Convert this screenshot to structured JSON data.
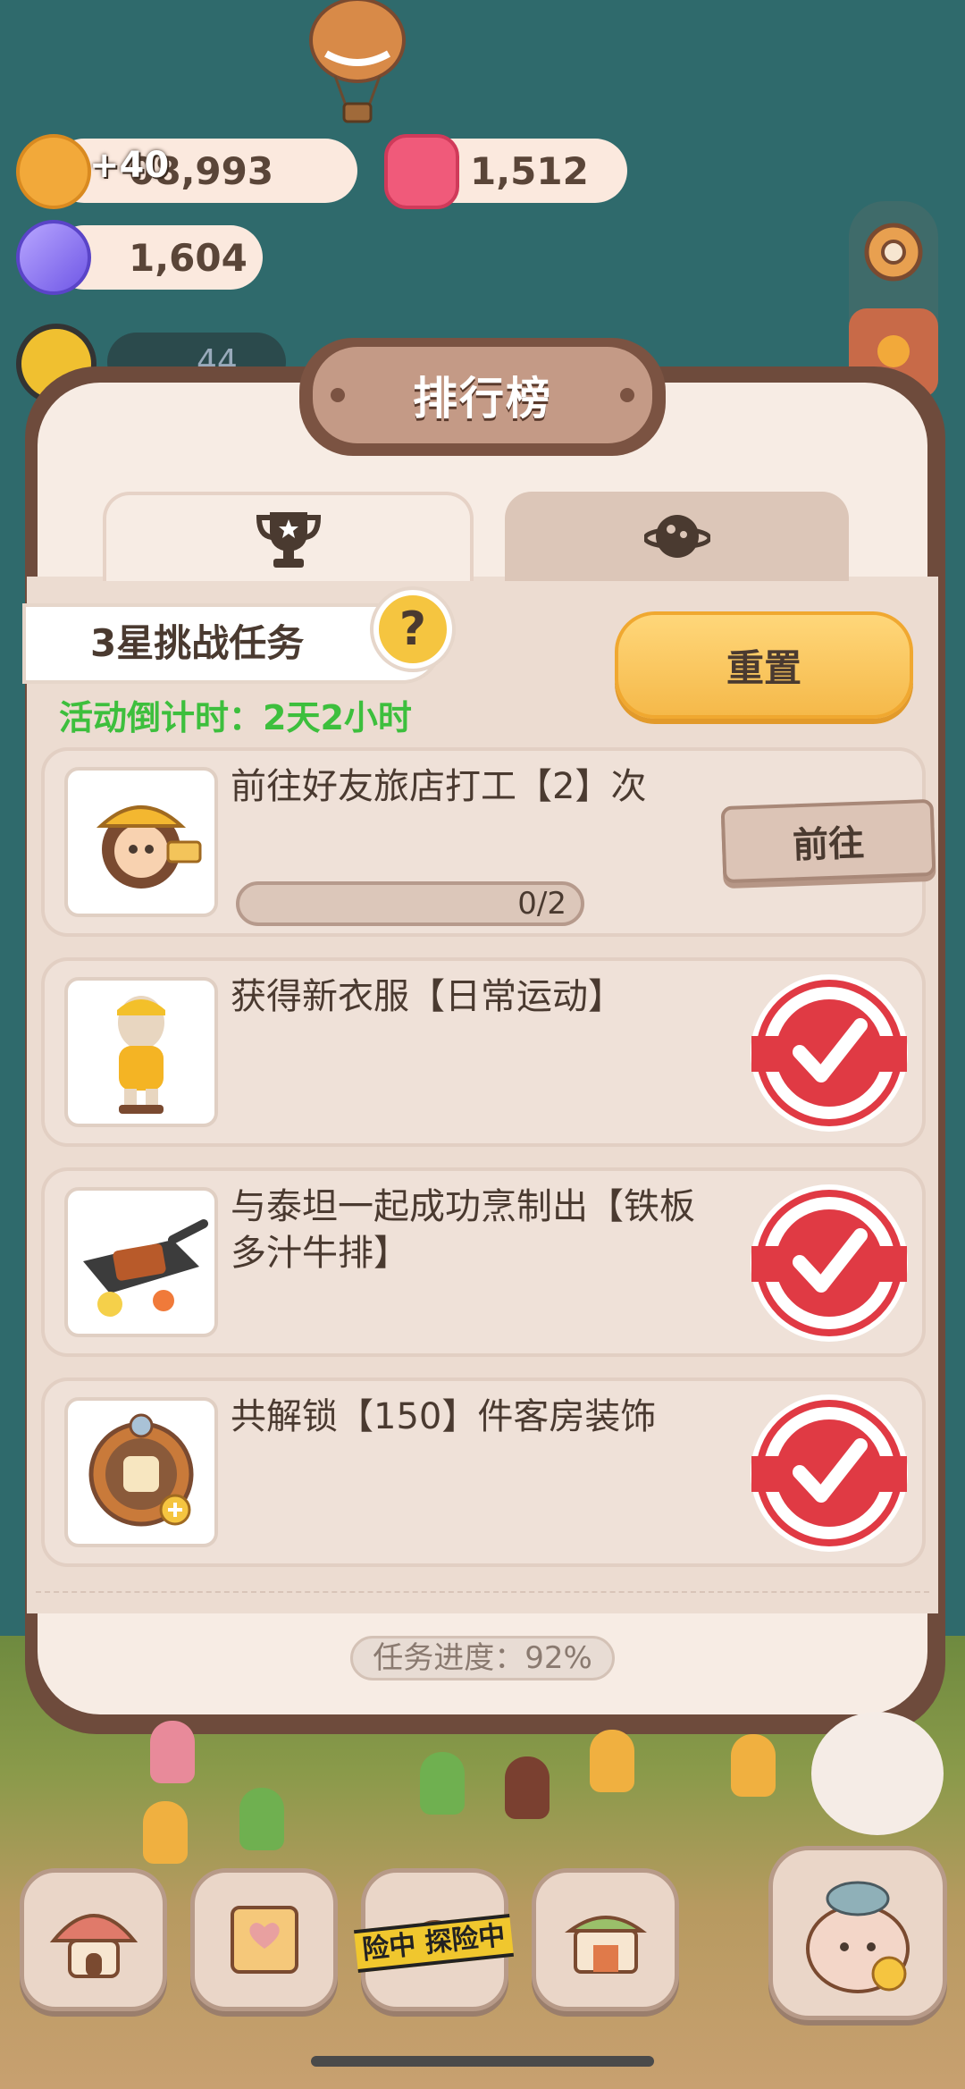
{
  "resources": {
    "cookies": {
      "plus": "+40",
      "value": "08,993",
      "icon": "cookie-icon"
    },
    "gems": {
      "value": "1,512",
      "icon": "pink-gem-icon"
    },
    "crystals": {
      "value": "1,604",
      "icon": "crystal-icon"
    },
    "partial_count": "44"
  },
  "panel": {
    "title": "排行榜",
    "tabs": [
      {
        "icon": "trophy-icon",
        "active": true
      },
      {
        "icon": "planet-icon",
        "active": false
      }
    ],
    "challenge_label": "3星挑战任务",
    "help_symbol": "?",
    "countdown": "活动倒计时：2天2小时",
    "reset_label": "重置",
    "tasks": [
      {
        "text": "前往好友旅店打工【2】次",
        "progress": "0/2",
        "action": "前往",
        "completed": false,
        "thumb": "worker-girl-icon"
      },
      {
        "text": "获得新衣服【日常运动】",
        "completed": true,
        "thumb": "sport-outfit-icon"
      },
      {
        "text": "与泰坦一起成功烹制出【铁板多汁牛排】",
        "completed": true,
        "thumb": "steak-plate-icon"
      },
      {
        "text": "共解锁【150】件客房装饰",
        "completed": true,
        "thumb": "room-decor-icon"
      }
    ],
    "overall_progress": "任务进度：92%"
  },
  "bottom_nav": {
    "explore_label": "险中 探险中"
  },
  "colors": {
    "background": "#2f6a6c",
    "panel_frame": "#6e4b3c",
    "countdown_green": "#3dbf3d",
    "reset_yellow": "#f5b94a",
    "stamp_red": "#e03a44"
  }
}
